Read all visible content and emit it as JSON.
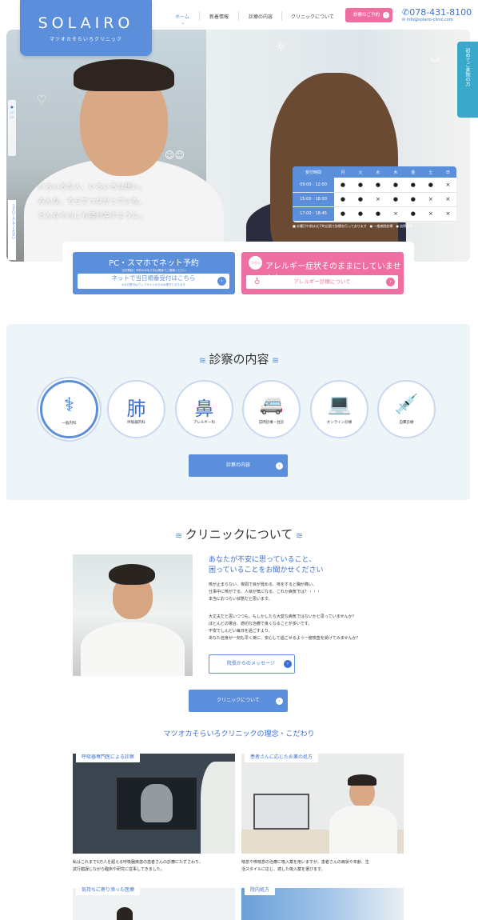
{
  "header": {
    "logo_title": "SOLAIRO",
    "logo_sub": "マツオカそらいろクリニック",
    "nav": [
      "ホーム",
      "新着情報",
      "診療の内容",
      "クリニックについて"
    ],
    "reserve": "診察のご予約",
    "tel": "078-431-8100",
    "mail": "info@solairo-clinic.com"
  },
  "hero": {
    "lines": [
      "いろいろな人、いろいろな想い。",
      "みんな、そらでつながっている。",
      "どんなそらにも陽が差すように。"
    ],
    "scroll": "スクロールしてください",
    "dots_label": "● ○ ○"
  },
  "side_tab": "初めてご来院の方",
  "schedule": {
    "header": [
      "受付時間",
      "月",
      "火",
      "水",
      "木",
      "金",
      "土",
      "日"
    ],
    "rows": [
      {
        "time": "09:00 - 12:00",
        "cells": [
          "●",
          "●",
          "●",
          "●",
          "●",
          "●",
          "×"
        ]
      },
      {
        "time": "15:00 - 18:00",
        "cells": [
          "●",
          "●",
          "×",
          "●",
          "●",
          "×",
          "×"
        ]
      },
      {
        "time": "17:00 - 18:45",
        "cells": [
          "●",
          "●",
          "●",
          "×",
          "●",
          "×",
          "×"
        ]
      }
    ],
    "legend": "■ 水曜日午前は太子町出張で診療を行っております　● 一般病院診療　● 訪問診療"
  },
  "banners": {
    "net_title": "PC・スマホでネット予約",
    "net_note": "当日電話と予約のみなさまは電話でご連絡ください",
    "net_button": "ネットで当日順番受付はこちら",
    "net_button_note": "※当日受付はウェブサイトからのみ受付となります",
    "allergy_badge": "つらい",
    "allergy_title": "アレルギー症状そのままにしていませんか?",
    "allergy_button": "アレルギー診療について"
  },
  "services": {
    "title": "診察の内容",
    "items": [
      {
        "label": "一般内科",
        "icon": "⚕"
      },
      {
        "label": "呼吸器内科",
        "icon": "肺"
      },
      {
        "label": "アレルギー科",
        "icon": "鼻"
      },
      {
        "label": "訪問診療・往診",
        "icon": "🚐"
      },
      {
        "label": "オンライン診療",
        "icon": "💻"
      },
      {
        "label": "自費診療",
        "icon": "💉"
      }
    ],
    "button": "診察の内容"
  },
  "about": {
    "title": "クリニックについて",
    "heading1": "あなたが不安に思っていること、",
    "heading2": "困っていることをお聞かせください",
    "p1": [
      "咳が止まらない、夜間で目が覚める、咳をすると胸が痛い、",
      "仕事中に咳がでる、人目が気になる、これか病気では？・・・",
      "本当におつらい状態だと思います。"
    ],
    "p2": [
      "大丈夫だと思いつつも、もしかしたら大変な病気ではないかと思っていませんか？",
      "ほとんどの場合、適切な治療で良くなることが多いです。",
      "不安でしんどい毎日を過ごすより、",
      "あなた自身が一刻も早く楽に、安心して過ごせるよう一度検査を受けてみませんか？"
    ],
    "msg_button": "院長からのメッセージ",
    "button": "クリニックについて"
  },
  "philosophy": {
    "title": "マツオカそらいろクリニックの理念・こだわり",
    "cards": [
      {
        "tag": "呼吸器専門医による診察",
        "text": [
          "私はこれまで1万人を超える呼吸器疾患の患者さんの診療にたずさわり、",
          "試行錯誤しながら臨床や研究に従事してきました。"
        ]
      },
      {
        "tag": "患者さんに応じたお薬の処方",
        "text": [
          "喘息や咳喘息の治療に吸入薬を用いますが、患者さんの病状や年齢、生",
          "活スタイルに応じ、適した吸入薬を選びます。"
        ]
      },
      {
        "tag": "気持ちに寄り添った医療",
        "text": []
      },
      {
        "tag": "院内処方",
        "text": []
      }
    ]
  }
}
